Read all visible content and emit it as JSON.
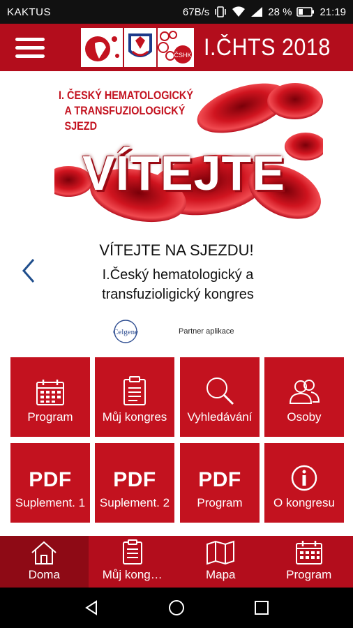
{
  "status_bar": {
    "carrier": "KAKTUS",
    "net_speed": "67B/s",
    "battery": "28 %",
    "time": "21:19"
  },
  "app_bar": {
    "title": "I.ČHTS 2018",
    "logo_text": "ČSHK"
  },
  "banner": {
    "subtitle_line1": "I.  ČESKÝ HEMATOLOGICKÝ",
    "subtitle_line2": "A TRANSFUZIOLOGICKÝ",
    "subtitle_line3": "SJEZD",
    "headline": "VÍTEJTE"
  },
  "carousel": {
    "heading": "VÍTEJTE NA SJEZDU!",
    "description": "I.Český hematologický a transfuzioligický kongres"
  },
  "partner": {
    "logo_text": "Celgene",
    "label": "Partner aplikace"
  },
  "tiles": [
    {
      "label": "Program",
      "icon": "calendar-icon"
    },
    {
      "label": "Můj kongres",
      "icon": "clipboard-icon"
    },
    {
      "label": "Vyhledávání",
      "icon": "search-icon"
    },
    {
      "label": "Osoby",
      "icon": "people-icon"
    },
    {
      "label": "Suplement. 1",
      "icon_text": "PDF"
    },
    {
      "label": "Suplement. 2",
      "icon_text": "PDF"
    },
    {
      "label": "Program",
      "icon_text": "PDF"
    },
    {
      "label": "O kongresu",
      "icon": "info-icon"
    }
  ],
  "bottom_nav": [
    {
      "label": "Doma",
      "icon": "home-icon",
      "active": true
    },
    {
      "label": "Můj kong…",
      "icon": "clipboard-icon"
    },
    {
      "label": "Mapa",
      "icon": "map-icon"
    },
    {
      "label": "Program",
      "icon": "calendar-icon"
    }
  ],
  "colors": {
    "brand_red": "#b30d1c",
    "tile_red": "#c3121f",
    "active_nav": "#8e0a15"
  }
}
